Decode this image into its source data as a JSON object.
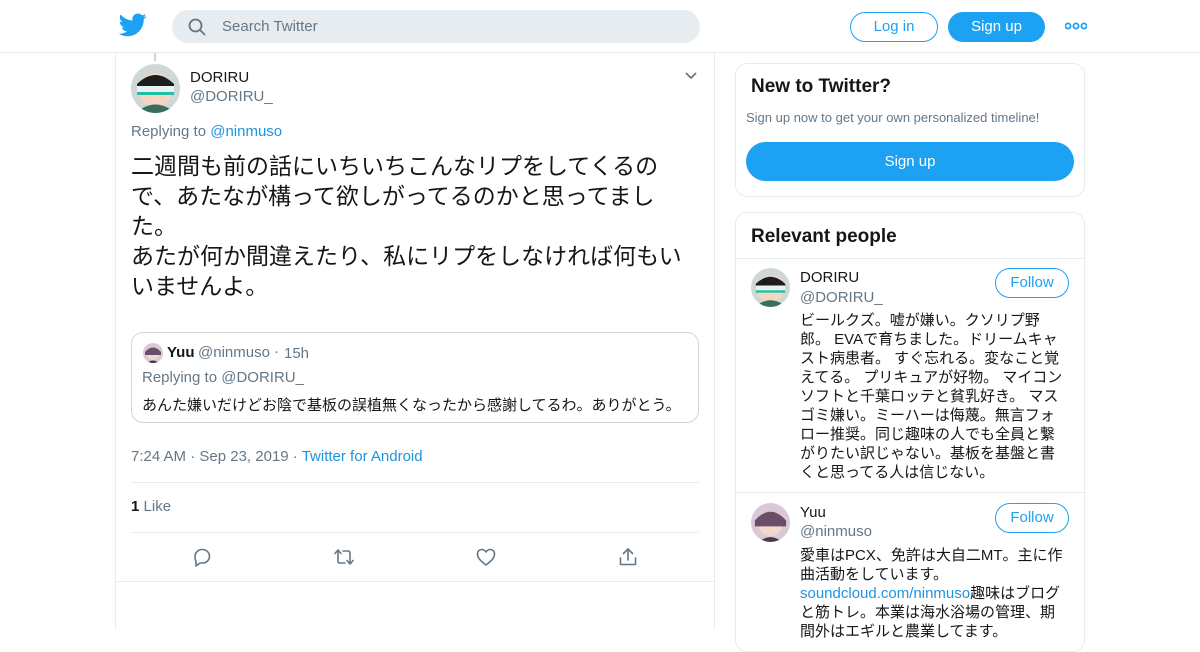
{
  "header": {
    "search_placeholder": "Search Twitter",
    "login_label": "Log in",
    "signup_label": "Sign up",
    "logo_icon": "twitter-bird-icon",
    "more_icon": "more-dots-icon"
  },
  "tweet": {
    "author_name": "DORIRU",
    "author_handle": "@DORIRU_",
    "replying_prefix": "Replying to",
    "replying_handle": "@ninmuso",
    "text": "二週間も前の話にいちいちこんなリプをしてくるので、あたなが構って欲しがってるのかと思ってました。\nあたが何か間違えたり、私にリプをしなければ何もいいませんよ。",
    "quoted": {
      "name": "Yuu",
      "handle": "@ninmuso",
      "separator": "·",
      "time": "15h",
      "replying_prefix": "Replying to",
      "replying_handle": "@DORIRU_",
      "text": "あんた嫌いだけどお陰で基板の誤植無くなったから感謝してるわ。ありがとう。"
    },
    "time": "7:24 AM",
    "separator": "·",
    "date": "Sep 23, 2019",
    "source": "Twitter for Android",
    "like_count": "1",
    "like_label": "Like",
    "actions": [
      "reply-icon",
      "retweet-icon",
      "like-icon",
      "share-icon"
    ]
  },
  "sidebar": {
    "new_to_twitter": {
      "title": "New to Twitter?",
      "subtitle": "Sign up now to get your own personalized timeline!",
      "button": "Sign up"
    },
    "relevant_people": {
      "title": "Relevant people",
      "follow_label": "Follow",
      "people": [
        {
          "name": "DORIRU",
          "handle": "@DORIRU_",
          "bio": "ビールクズ。嘘が嫌い。クソリプ野郎。 EVAで育ちました。ドリームキャスト病患者。 すぐ忘れる。変なこと覚えてる。 プリキュアが好物。 マイコンソフトと千葉ロッテと貧乳好き。 マスゴミ嫌い。ミーハーは侮蔑。無言フォロー推奨。同じ趣味の人でも全員と繋がりたい訳じゃない。基板を基盤と書くと思ってる人は信じない。"
        },
        {
          "name": "Yuu",
          "handle": "@ninmuso",
          "bio_before": "愛車はPCX、免許は大自二MT。主に作曲活動をしています。",
          "bio_link": "soundcloud.com/ninmuso",
          "bio_after": "趣味はブログと筋トレ。本業は海水浴場の管理、期間外はエギルと農業してます。"
        }
      ]
    }
  },
  "colors": {
    "accent": "#1da1f2",
    "link": "#1b95e0",
    "muted": "#657786",
    "border": "#e6ecf0"
  }
}
